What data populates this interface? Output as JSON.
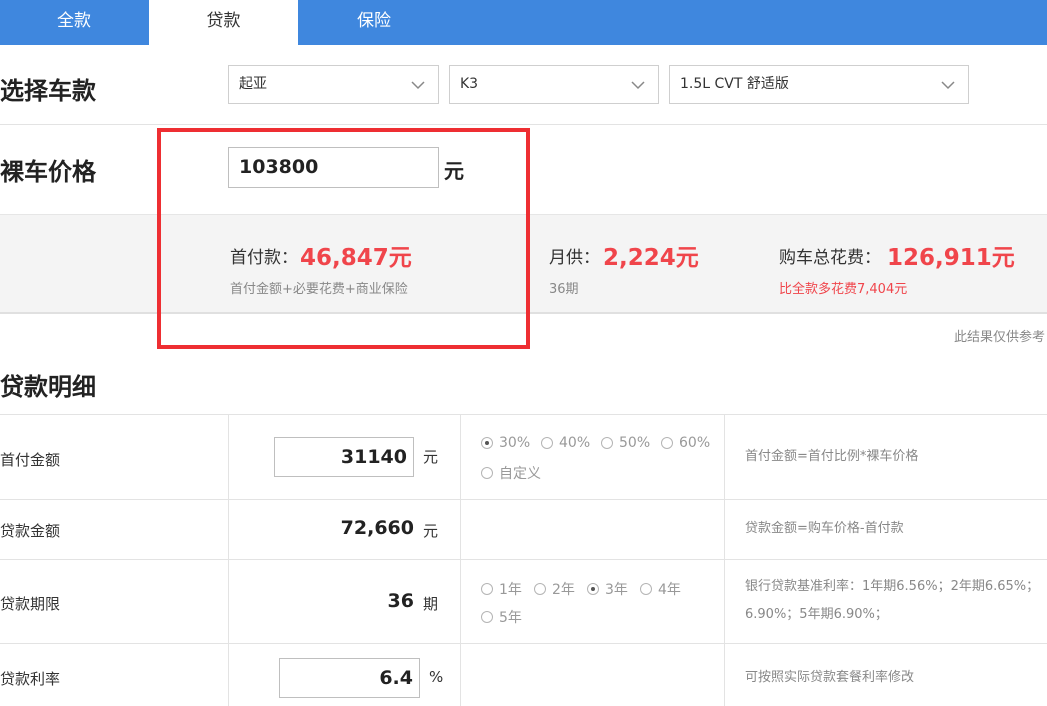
{
  "tabs": [
    {
      "label": "全款",
      "active": false
    },
    {
      "label": "贷款",
      "active": true
    },
    {
      "label": "保险",
      "active": false
    }
  ],
  "select_car": {
    "title": "选择车款",
    "brand": "起亚",
    "model": "K3",
    "trim": "1.5L CVT 舒适版",
    "dropdown_icon": "chevron-down-icon"
  },
  "bare_price": {
    "title": "裸车价格",
    "value": "103800",
    "unit": "元"
  },
  "summary": {
    "down_payment_label": "首付款：",
    "down_payment_value": "46,847元",
    "down_payment_sub": "首付金额+必要花费+商业保险",
    "monthly_label": "月供：",
    "monthly_value": "2,224元",
    "monthly_sub": "36期",
    "total_label": "购车总花费：",
    "total_value": "126,911元",
    "total_sub": "比全款多花费7,404元"
  },
  "note": "此结果仅供参考",
  "loan_detail": {
    "title": "贷款明细",
    "rows": {
      "down_amount": {
        "label": "首付金额",
        "value": "31140",
        "unit": "元",
        "options": [
          "30%",
          "40%",
          "50%",
          "60%",
          "自定义"
        ],
        "selected": "30%",
        "hint": "首付金额=首付比例*裸车价格"
      },
      "loan_amount": {
        "label": "贷款金额",
        "value": "72,660",
        "unit": "元",
        "hint": "贷款金额=购车价格-首付款"
      },
      "loan_term": {
        "label": "贷款期限",
        "value": "36",
        "unit": "期",
        "options": [
          "1年",
          "2年",
          "3年",
          "4年",
          "5年"
        ],
        "selected": "3年",
        "hint_line1": "银行贷款基准利率：1年期6.56%；2年期6.65%；",
        "hint_line2": "6.90%；5年期6.90%；"
      },
      "loan_rate": {
        "label": "贷款利率",
        "value": "6.4",
        "unit": "%",
        "hint": "可按照实际贷款套餐利率修改"
      }
    }
  },
  "colors": {
    "tab_blue": "#3f87de",
    "accent_red": "#f0454b",
    "highlight_red": "#ee2e32"
  }
}
